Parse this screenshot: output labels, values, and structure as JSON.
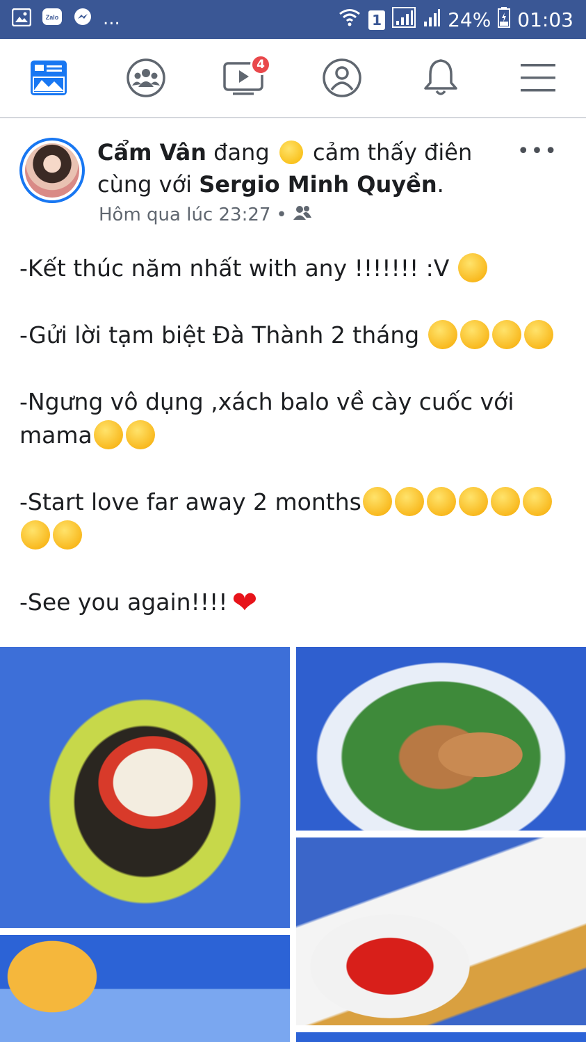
{
  "status_bar": {
    "left_icons": [
      "image-icon",
      "zalo-icon",
      "messenger-icon"
    ],
    "more": "...",
    "sim_label": "1",
    "battery_percent": "24%",
    "time": "01:03"
  },
  "nav": {
    "items": [
      {
        "name": "news-feed",
        "icon": "news-feed-icon",
        "active": true
      },
      {
        "name": "groups",
        "icon": "groups-icon"
      },
      {
        "name": "watch",
        "icon": "watch-icon",
        "badge": "4"
      },
      {
        "name": "profile",
        "icon": "profile-icon"
      },
      {
        "name": "notifications",
        "icon": "bell-icon"
      },
      {
        "name": "menu",
        "icon": "hamburger-icon"
      }
    ]
  },
  "post": {
    "author": "Cẩm Vân",
    "feeling_prefix": "đang",
    "feeling": "cảm thấy điên",
    "with_prefix": "cùng với",
    "tagged": "Sergio Minh Quyền",
    "tagged_suffix": ".",
    "timestamp": "Hôm qua lúc 23:27",
    "separator": "•",
    "audience_icon": "friends-icon",
    "more": "•••",
    "lines": [
      "-Kết thúc năm nhất with any !!!!!!! :V",
      "-Gửi lời tạm biệt Đà Thành 2 tháng",
      "-Ngưng vô dụng ,xách balo về cày cuốc với mama",
      "-Start love far away 2 months",
      "-See you again!!!!"
    ]
  },
  "colors": {
    "status_bar": "#3a5795",
    "accent": "#1877f2",
    "badge": "#e9484b",
    "heart": "#e7131a"
  }
}
